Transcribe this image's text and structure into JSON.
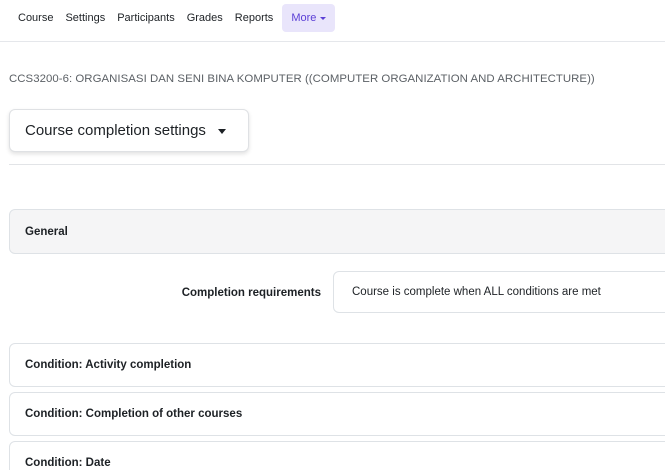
{
  "nav": {
    "items": [
      "Course",
      "Settings",
      "Participants",
      "Grades",
      "Reports"
    ],
    "more_label": "More"
  },
  "course": {
    "title": "CCS3200-6: ORGANISASI DAN SENI BINA KOMPUTER ((COMPUTER ORGANIZATION AND ARCHITECTURE))"
  },
  "selector": {
    "label": "Course completion settings"
  },
  "sections": {
    "general": "General",
    "activity": "Condition: Activity completion",
    "other_courses": "Condition: Completion of other courses",
    "date": "Condition: Date"
  },
  "requirements": {
    "label": "Completion requirements",
    "value": "Course is complete when ALL conditions are met"
  },
  "colors": {
    "accent": "#5b3fd6",
    "accent_bg": "#e9e5fb"
  }
}
